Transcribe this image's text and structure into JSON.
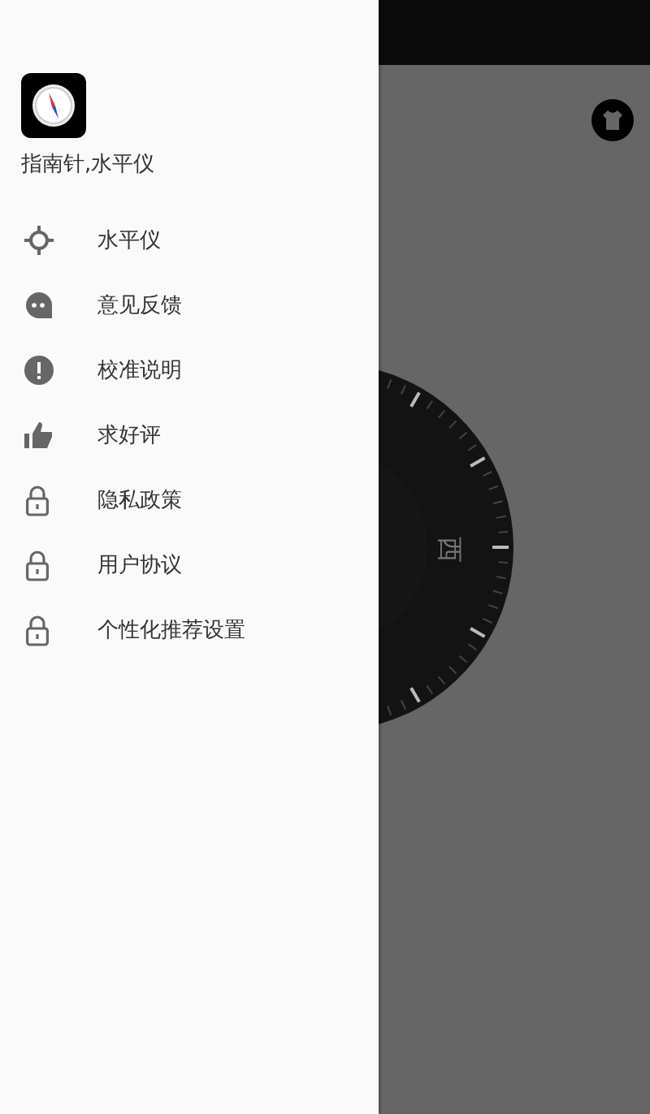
{
  "drawer": {
    "app_name": "指南针,水平仪",
    "items": [
      {
        "kind": "level",
        "label": "水平仪"
      },
      {
        "kind": "feedback",
        "label": "意见反馈"
      },
      {
        "kind": "info",
        "label": "校准说明"
      },
      {
        "kind": "rate",
        "label": "求好评"
      },
      {
        "kind": "lock",
        "label": "隐私政策"
      },
      {
        "kind": "lock",
        "label": "用户协议"
      },
      {
        "kind": "lock",
        "label": "个性化推荐设置"
      }
    ]
  },
  "compass": {
    "west_label": "西"
  }
}
